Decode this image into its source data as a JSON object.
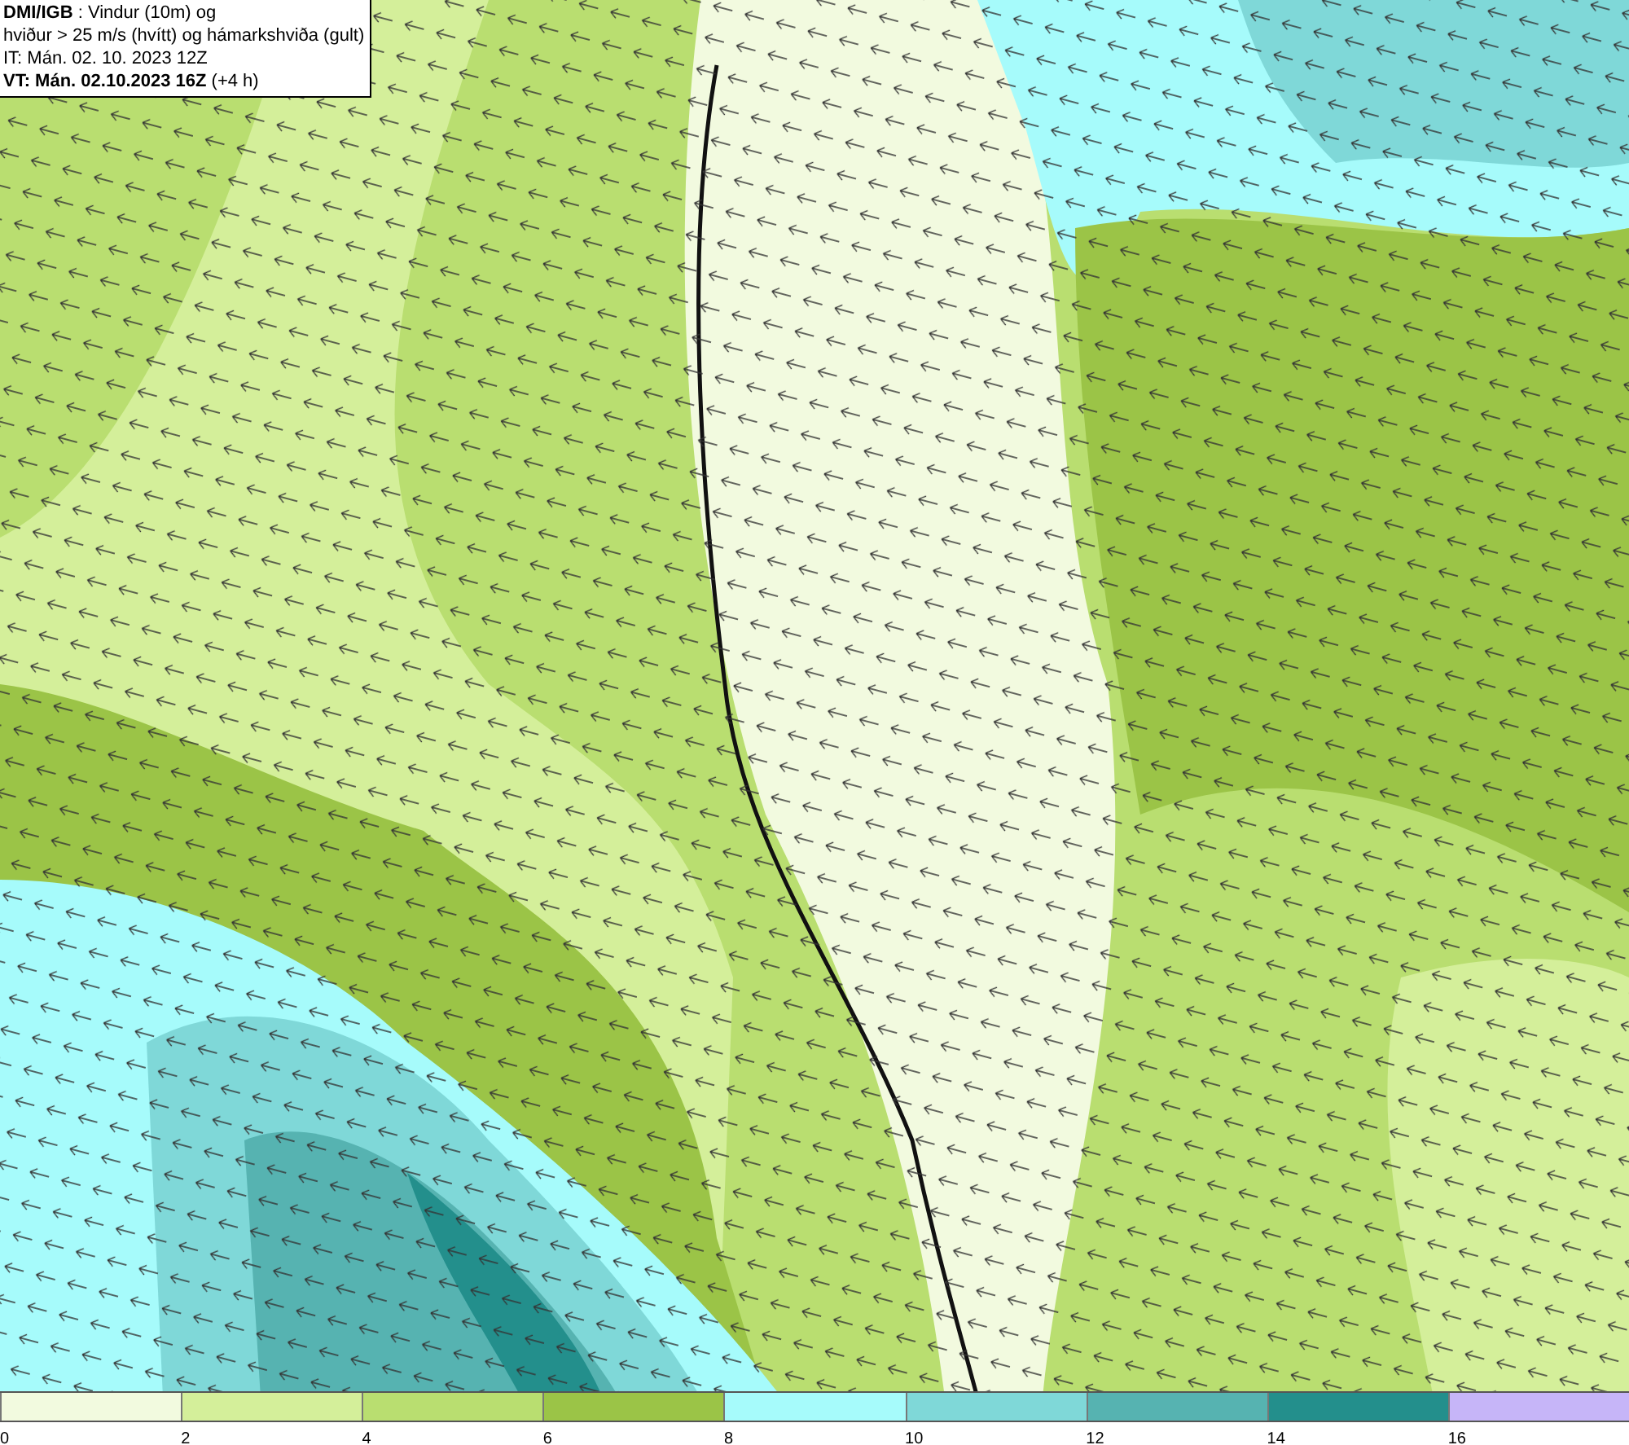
{
  "header": {
    "lines": [
      "**DMI/IGB** : Vindur (10m) og",
      "hviður > 25 m/s (hvítt) og hámarkshviða (gult)",
      "IT: Mán. 02. 10. 2023 12Z",
      "**VT: Mán. 02.10.2023 16Z** (+4 h)"
    ]
  },
  "legend": {
    "segments": [
      {
        "label": "0",
        "color": "#f2fadf"
      },
      {
        "label": "2",
        "color": "#d4ef9a"
      },
      {
        "label": "4",
        "color": "#b9de70"
      },
      {
        "label": "6",
        "color": "#9bc447"
      },
      {
        "label": "8",
        "color": "#a6fbfb"
      },
      {
        "label": "10",
        "color": "#7fd8d8"
      },
      {
        "label": "12",
        "color": "#56b3b1"
      },
      {
        "label": "14",
        "color": "#238f8c"
      },
      {
        "label": "16",
        "color": "#c6b5f8"
      }
    ]
  }
}
